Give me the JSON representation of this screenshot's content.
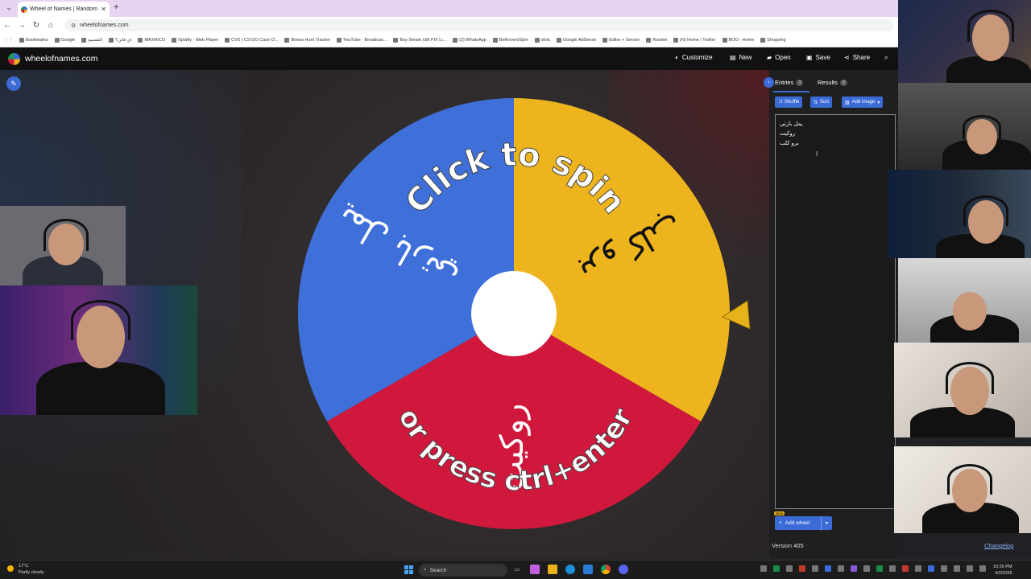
{
  "browser": {
    "tab_title": "Wheel of Names | Random nam",
    "address": "wheelofnames.com",
    "bookmarks": [
      "Bookmarks",
      "Google",
      "التقسيم",
      "اي فاتن؟",
      "MAXHICO",
      "Spotify - Web Player",
      "CVS | CS:GO Case O...",
      "Bonus Hunt Tracker",
      "YouTube - Broadcas...",
      "Buy Steam Gift PIX Li...",
      "(2) WhatsApp",
      "Bethoven/Spin",
      "slots",
      "Google AdSense",
      "Editor + Sensor",
      "Roobet",
      "(N) Home / Twitter",
      "BOO - Home",
      "Shopping"
    ]
  },
  "site": {
    "title": "wheelofnames.com",
    "nav": {
      "customize": "Customize",
      "new": "New",
      "open": "Open",
      "save": "Save",
      "share": "Share"
    }
  },
  "wheel": {
    "prompt_line1": "Click to spin",
    "prompt_line2": "or press ctrl+enter",
    "segments": [
      {
        "label": "يمل بارتي",
        "color": "#3f6fd9"
      },
      {
        "label": "برو كلب",
        "color": "#edb41e"
      },
      {
        "label": "روكيت",
        "color": "#d0183d"
      }
    ],
    "pointer_color": "#e8b21b"
  },
  "sidebar": {
    "tabs": [
      {
        "label": "Entries",
        "count": "3"
      },
      {
        "label": "Results",
        "count": "0"
      }
    ],
    "shuffle_label": "Shuffle",
    "sort_label": "Sort",
    "add_image_label": "Add image",
    "entries": [
      "يمل بارتي",
      "روكيت",
      "برو كلب"
    ],
    "beta_badge": "Beta",
    "add_wheel_label": "Add wheel",
    "version": "Version 405",
    "changelog": "Changelog"
  },
  "taskbar": {
    "weather_temp": "17°C",
    "weather_desc": "Partly cloudy",
    "search_placeholder": "Search",
    "time": "10:26 PM",
    "date": "4/2/2026"
  },
  "colors": {
    "accent": "#3b6bd6",
    "header_bg": "#111111",
    "stage_bg": "#2a2627"
  }
}
